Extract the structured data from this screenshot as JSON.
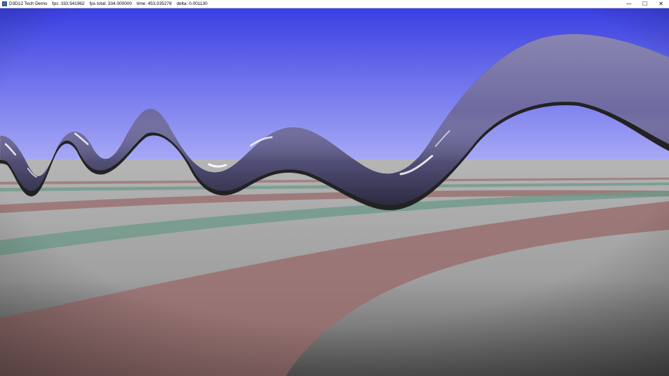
{
  "window": {
    "app_title": "D3D12 Tech Demo",
    "stats": [
      "fps: 333.541962",
      "fps total: 334.000000",
      "time: 453.035278",
      "delta: 0.001130"
    ],
    "icons": [
      "app-icon",
      "minimize-icon",
      "maximize-icon",
      "close-icon"
    ]
  },
  "scene": {
    "colors": {
      "sky_top": "#3a3fe2",
      "sky_horizon": "#a7a9f5",
      "ground": "#a8a8a8",
      "ground_dark": "#5a5a5a",
      "stripe_red": "#9a6e6e",
      "stripe_green": "#6e9a8a",
      "tube_stripes": [
        "#5f8f74",
        "#9a7a5c",
        "#6e6aa0",
        "#8f6aa0",
        "#9aa05c",
        "#6a8fa0",
        "#a0785c"
      ]
    }
  }
}
